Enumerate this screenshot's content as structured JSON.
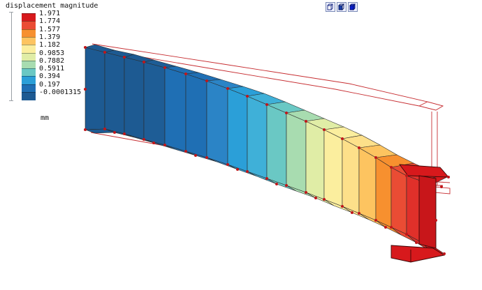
{
  "legend": {
    "title": "displacement magnitude",
    "unit": "mm",
    "levels": [
      {
        "label": "1.971",
        "color": "#d7191c"
      },
      {
        "label": "1.774",
        "color": "#ea4c34"
      },
      {
        "label": "1.577",
        "color": "#f7902f"
      },
      {
        "label": "1.379",
        "color": "#fdc460"
      },
      {
        "label": "1.182",
        "color": "#fbee9e"
      },
      {
        "label": "0.9853",
        "color": "#e0eda6"
      },
      {
        "label": "0.7882",
        "color": "#a8dcb0"
      },
      {
        "label": "0.5911",
        "color": "#6ac8c4"
      },
      {
        "label": "0.394",
        "color": "#2b9fd8"
      },
      {
        "label": "0.197",
        "color": "#1f6fb4"
      },
      {
        "label": "-0.0001315",
        "color": "#1d5a92"
      }
    ]
  },
  "toolbar": {
    "buttons": [
      {
        "name": "view-front-icon",
        "fill": "#ffffff"
      },
      {
        "name": "view-iso-icon",
        "fill": "#1a3ea8"
      },
      {
        "name": "view-solid-icon",
        "fill": "#0a1ed0"
      }
    ]
  },
  "colors": {
    "mesh": "#c0161a",
    "edge": "#5a0a0a"
  }
}
